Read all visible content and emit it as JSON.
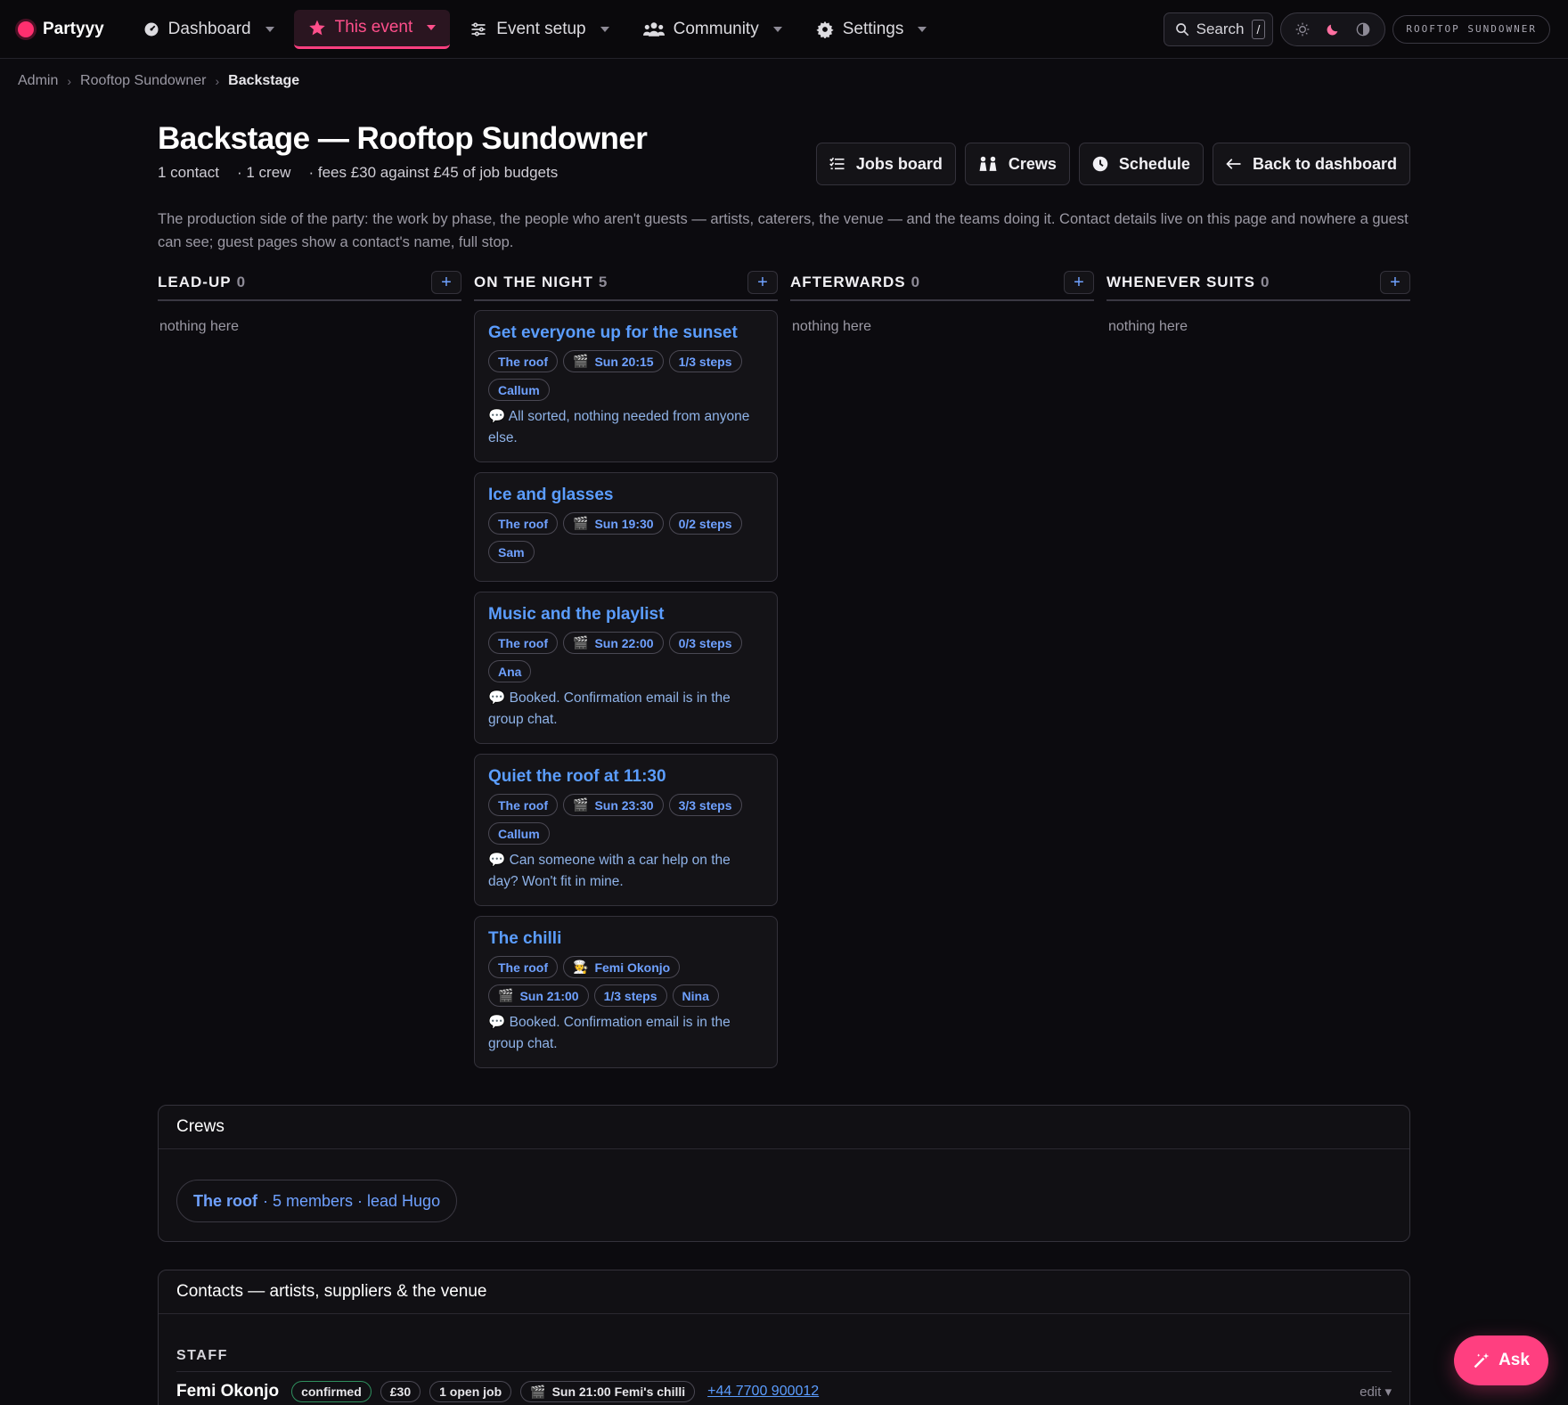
{
  "nav": {
    "brand": "Partyyy",
    "items": [
      {
        "label": "Dashboard",
        "icon": "gauge-icon"
      },
      {
        "label": "This event",
        "icon": "star-icon",
        "active": true
      },
      {
        "label": "Event setup",
        "icon": "sliders-icon"
      },
      {
        "label": "Community",
        "icon": "users-icon"
      },
      {
        "label": "Settings",
        "icon": "gear-icon"
      }
    ],
    "search_label": "Search",
    "search_key": "/",
    "event_name": "ROOFTOP SUNDOWNER"
  },
  "breadcrumb": [
    "Admin",
    "Rooftop Sundowner",
    "Backstage"
  ],
  "header": {
    "title": "Backstage — Rooftop Sundowner",
    "stat_contacts": "1 contact",
    "stat_crews": "· 1 crew",
    "stat_fees": "· fees £30 against £45 of job budgets",
    "intro": "The production side of the party: the work by phase, the people who aren't guests — artists, caterers, the venue — and the teams doing it. Contact details live on this page and nowhere a guest can see; guest pages show a contact's name, full stop."
  },
  "actions": {
    "jobs_board": "Jobs board",
    "crews": "Crews",
    "schedule": "Schedule",
    "back": "Back to dashboard"
  },
  "board": {
    "empty_label": "nothing here",
    "columns": [
      {
        "title": "LEAD-UP",
        "count": "0"
      },
      {
        "title": "ON THE NIGHT",
        "count": "5"
      },
      {
        "title": "AFTERWARDS",
        "count": "0"
      },
      {
        "title": "WHENEVER SUITS",
        "count": "0"
      }
    ],
    "cards": [
      {
        "title": "Get everyone up for the sunset",
        "crew": "The roof",
        "time": "Sun 20:15",
        "steps": "1/3 steps",
        "person": "Callum",
        "note": "All sorted, nothing needed from anyone else."
      },
      {
        "title": "Ice and glasses",
        "crew": "The roof",
        "time": "Sun 19:30",
        "steps": "0/2 steps",
        "person": "Sam"
      },
      {
        "title": "Music and the playlist",
        "crew": "The roof",
        "time": "Sun 22:00",
        "steps": "0/3 steps",
        "person": "Ana",
        "note": "Booked. Confirmation email is in the group chat."
      },
      {
        "title": "Quiet the roof at 11:30",
        "crew": "The roof",
        "time": "Sun 23:30",
        "steps": "3/3 steps",
        "person": "Callum",
        "note": "Can someone with a car help on the day? Won't fit in mine."
      },
      {
        "title": "The chilli",
        "crew": "The roof",
        "contact": "Femi Okonjo",
        "time": "Sun 21:00",
        "steps": "1/3 steps",
        "person": "Nina",
        "note": "Booked. Confirmation email is in the group chat."
      }
    ]
  },
  "crews_panel": {
    "title": "Crews",
    "crew_name": "The roof",
    "crew_detail": "· 5 members · lead Hugo"
  },
  "contacts_panel": {
    "title": "Contacts — artists, suppliers & the venue",
    "group": "STAFF",
    "contact": {
      "name": "Femi Okonjo",
      "status": "confirmed",
      "fee": "£30",
      "jobs": "1 open job",
      "slot": "Sun 21:00 Femi's chilli",
      "phone": "+44 7700 900012",
      "edit": "edit ▾"
    }
  },
  "ask_label": "Ask",
  "colors": {
    "accent": "#ff3f80",
    "link": "#5b9dff",
    "background": "#0c0b0f"
  }
}
